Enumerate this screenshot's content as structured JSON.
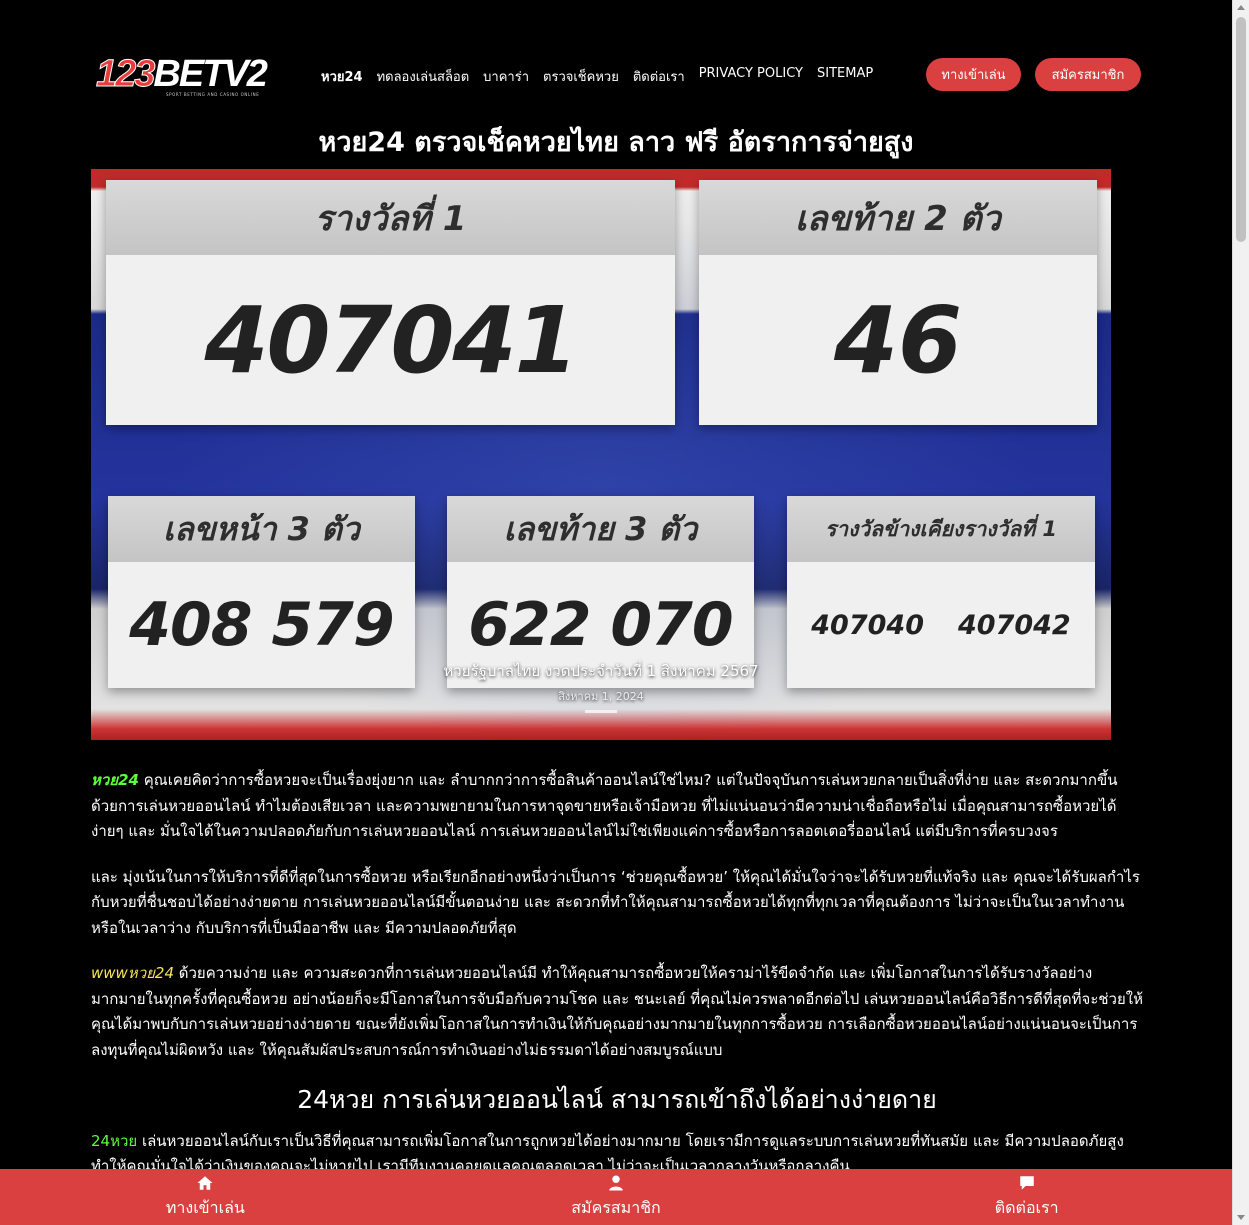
{
  "logo": {
    "num": "123",
    "bet": "BETV2",
    "tagline": "SPORT BETTING AND CASINO ONLINE"
  },
  "nav": {
    "items": [
      {
        "label": "หวย24"
      },
      {
        "label": "ทดลองเล่นสล็อต"
      },
      {
        "label": "บาคาร่า"
      },
      {
        "label": "ตรวจเช็คหวย"
      },
      {
        "label": "ติดต่อเรา"
      },
      {
        "label": "PRIVACY POLICY"
      },
      {
        "label": "SITEMAP"
      }
    ],
    "login_label": "ทางเข้าเล่น",
    "register_label": "สมัครสมาชิก"
  },
  "page_title": "หวย24 ตรวจเช็คหวยไทย ลาว ฟรี อัตราการจ่ายสูง",
  "banner": {
    "first_prize_head": "รางวัลที่ 1",
    "first_prize_value": "407041",
    "last2_head": "เลขท้าย 2 ตัว",
    "last2_value": "46",
    "front3_head": "เลขหน้า 3 ตัว",
    "front3_value": "408 579",
    "last3_head": "เลขท้าย 3 ตัว",
    "last3_value": "622 070",
    "near_head": "รางวัลข้างเคียงรางวัลที่ 1",
    "near_value_1": "407040",
    "near_value_2": "407042",
    "caption": "หวยรัฐบาลไทย งวดประจำวันที่ 1 สิงหาคม 2567",
    "date": "สิงหาคม 1, 2024"
  },
  "article": {
    "p1_kw": "หวย24",
    "p1": " คุณเคยคิดว่าการซื้อหวยจะเป็นเรื่องยุ่งยาก และ ลำบากกว่าการซื้อสินค้าออนไลน์ใช่ไหม? แต่ในปัจจุบันการเล่นหวยกลายเป็นสิ่งที่ง่าย และ สะดวกมากขึ้นด้วยการเล่นหวยออนไลน์ ทำไมต้องเสียเวลา และความพยายามในการหาจุดขายหรือเจ้ามือหวย ที่ไม่แน่นอนว่ามีความน่าเชื่อถือหรือไม่ เมื่อคุณสามารถซื้อหวยได้ง่ายๆ และ มั่นใจได้ในความปลอดภัยกับการเล่นหวยออนไลน์ การเล่นหวยออนไลน์ไม่ใช่เพียงแค่การซื้อหรือการลอตเตอรี่ออนไลน์ แต่มีบริการที่ครบวงจร",
    "p2": "และ มุ่งเน้นในการให้บริการที่ดีที่สุดในการซื้อหวย หรือเรียกอีกอย่างหนึ่งว่าเป็นการ ‘ช่วยคุณซื้อหวย’ ให้คุณได้มั่นใจว่าจะได้รับหวยที่แท้จริง และ คุณจะได้รับผลกำไรกับหวยที่ชื่นชอบได้อย่างง่ายดาย การเล่นหวยออนไลน์มีขั้นตอนง่าย และ สะดวกที่ทำให้คุณสามารถซื้อหวยได้ทุกที่ทุกเวลาที่คุณต้องการ ไม่ว่าจะเป็นในเวลาทำงานหรือในเวลาว่าง กับบริการที่เป็นมืออาชีพ และ มีความปลอดภัยที่สุด",
    "p3_kw": "wwwหวย24",
    "p3": " ด้วยความง่าย และ ความสะดวกที่การเล่นหวยออนไลน์มี ทำให้คุณสามารถซื้อหวยให้คราม่าไร้ขีดจำกัด และ เพิ่มโอกาสในการได้รับรางวัลอย่างมากมายในทุกครั้งที่คุณซื้อหวย อย่างน้อยก็จะมีโอกาสในการจับมือกับความโชค และ ชนะเลย์ ที่คุณไม่ควรพลาดอีกต่อไป เล่นหวยออนไลน์คือวิธีการดีที่สุดที่จะช่วยให้คุณได้มาพบกับการเล่นหวยอย่างง่ายดาย ขณะที่ยังเพิ่มโอกาสในการทำเงินให้กับคุณอย่างมากมายในทุกการซื้อหวย การเลือกซื้อหวยออนไลน์อย่างแน่นอนจะเป็นการลงทุนที่คุณไม่ผิดหวัง และ ให้คุณสัมผัสประสบการณ์การทำเงินอย่างไม่ธรรมดาได้อย่างสมบูรณ์แบบ",
    "h2": "24หวย การเล่นหวยออนไลน์ สามารถเข้าถึงได้อย่างง่ายดาย",
    "p4_kw": "24หวย",
    "p4": " เล่นหวยออนไลน์กับเราเป็นวิธีที่คุณสามารถเพิ่มโอกาสในการถูกหวยได้อย่างมากมาย โดยเรามีการดูแลระบบการเล่นหวยที่ทันสมัย และ มีความปลอดภัยสูง ทำให้คุณมั่นใจได้ว่าเงินของคุณจะไม่หายไป เรามีทีมงานคอยดูแลคุณตลอดเวลา ไม่ว่าจะเป็นเวลากลางวันหรือกลางคืน"
  },
  "bottom_bar": {
    "login_label": "ทางเข้าเล่น",
    "register_label": "สมัครสมาชิก",
    "contact_label": "ติดต่อเรา"
  },
  "colors": {
    "accent_red": "#d9403f",
    "keyword_green": "#5cff3c",
    "keyword_yellow": "#f6e35a",
    "background": "#000000"
  }
}
